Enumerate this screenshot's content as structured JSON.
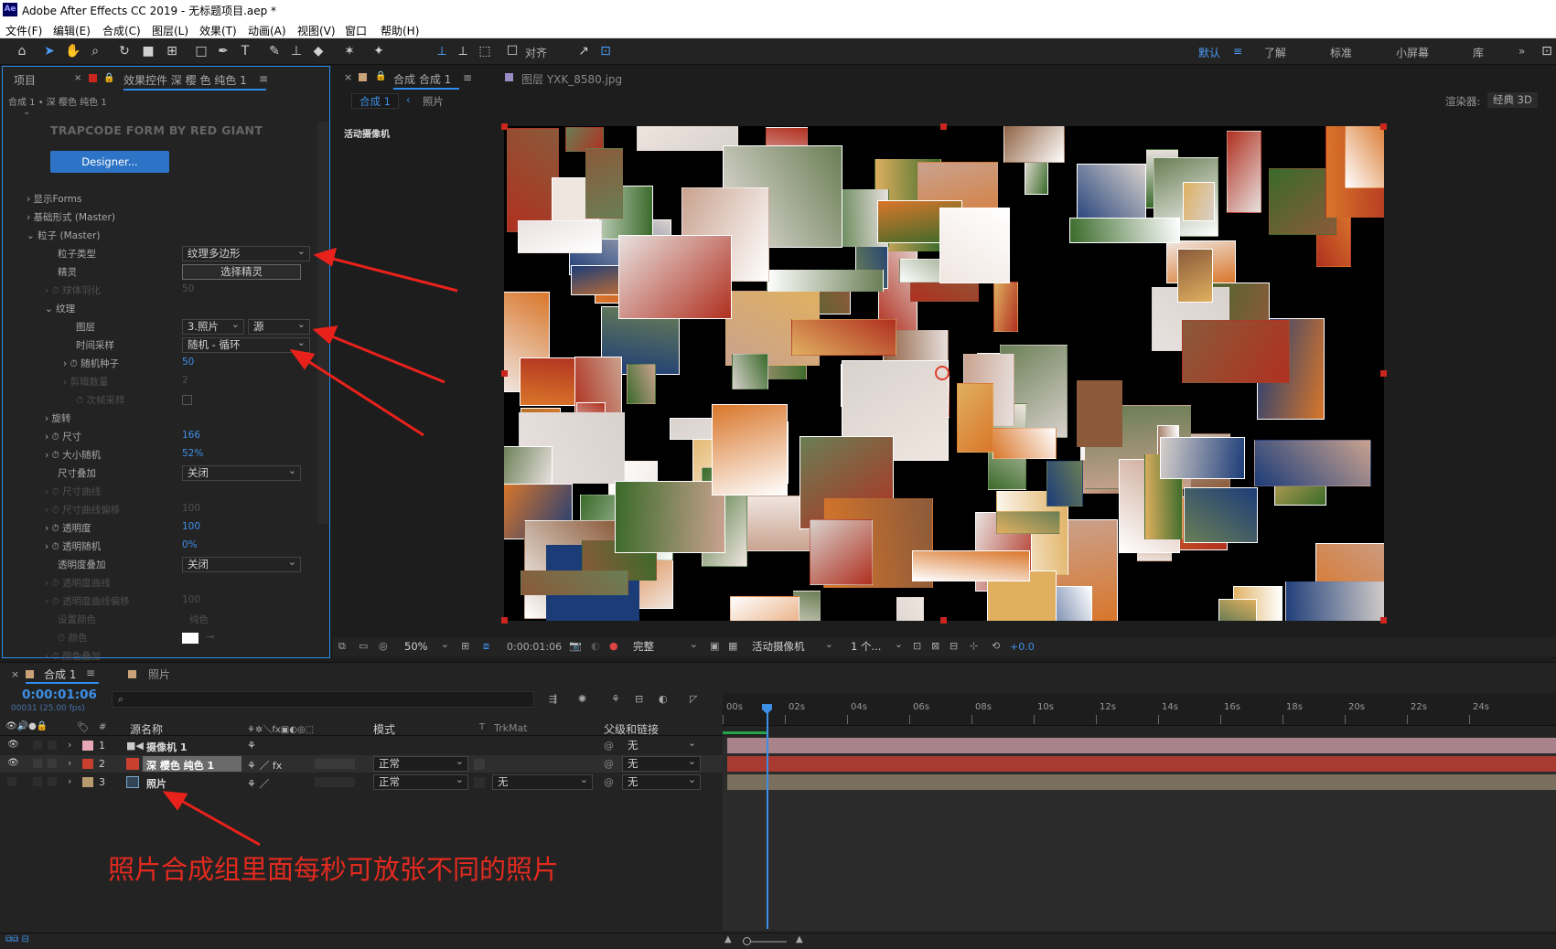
{
  "app": {
    "logo": "Ae",
    "title": "Adobe After Effects CC 2019 - 无标题项目.aep *"
  },
  "menu": [
    "文件(F)",
    "编辑(E)",
    "合成(C)",
    "图层(L)",
    "效果(T)",
    "动画(A)",
    "视图(V)",
    "窗口",
    "帮助(H)"
  ],
  "toolbar": {
    "align_label": "对齐",
    "workspaces": [
      "默认",
      "≡",
      "了解",
      "标准",
      "小屏幕",
      "库",
      "»"
    ]
  },
  "left_panel": {
    "tab_project": "项目",
    "tab_effects": "效果控件 深 樱 色 纯色 1",
    "breadcrumb": "合成 1 • 深 樱色 纯色 1",
    "plugin_title": "TRAPCODE FORM BY RED GIANT",
    "designer_button": "Designer...",
    "rows": [
      {
        "label": "显示Forms"
      },
      {
        "label": "基础形式 (Master)"
      },
      {
        "label": "粒子 (Master)"
      },
      {
        "label": "粒子类型"
      },
      {
        "label": "精灵"
      },
      {
        "label": "球体羽化",
        "value": "50"
      },
      {
        "label": "纹理"
      },
      {
        "label": "图层"
      },
      {
        "label": "时间采样"
      },
      {
        "label": "随机种子",
        "value": "50"
      },
      {
        "label": "剪辑数量",
        "value": "2"
      },
      {
        "label": "次帧采样"
      },
      {
        "label": "旋转"
      },
      {
        "label": "尺寸",
        "value": "166"
      },
      {
        "label": "大小随机",
        "value": "52%"
      },
      {
        "label": "尺寸叠加"
      },
      {
        "label": "尺寸曲线"
      },
      {
        "label": "尺寸曲线偏移",
        "value": "100"
      },
      {
        "label": "透明度",
        "value": "100"
      },
      {
        "label": "透明随机",
        "value": "0%"
      },
      {
        "label": "透明度叠加"
      },
      {
        "label": "透明度曲线"
      },
      {
        "label": "透明度曲线偏移",
        "value": "100"
      },
      {
        "label": "设置颜色",
        "value": "纯色"
      },
      {
        "label": "颜色"
      },
      {
        "label": "颜色叠加"
      }
    ],
    "particle_type": "纹理多边形",
    "sprite_button": "选择精灵",
    "layer_select": "3.照片",
    "layer_source": "源",
    "time_sampling": "随机 - 循环",
    "size_overlay": "关闭",
    "opacity_overlay": "关闭"
  },
  "comp_panel": {
    "tab_comp": "合成 合成 1",
    "tab_layer": "图层 YXK_8580.jpg",
    "sub_comp": "合成 1",
    "sub_photo": "照片",
    "renderer": "渲染器:",
    "renderer_value": "经典 3D",
    "camera_label": "活动摄像机"
  },
  "viewer_bar": {
    "zoom": "50%",
    "time": "0:00:01:06",
    "quality": "完整",
    "camera": "活动摄像机",
    "views": "1 个...",
    "exposure": "+0.0"
  },
  "timeline": {
    "tab_comp": "合成 1",
    "tab_photo": "照片",
    "timecode": "0:00:01:06",
    "frame": "00031 (25.00 fps)",
    "headers": {
      "source": "源名称",
      "mode": "模式",
      "t": "T",
      "trkmat": "TrkMat",
      "parent": "父级和链接"
    },
    "layers": [
      {
        "num": "1",
        "name": "摄像机 1",
        "mode": "",
        "trk": "",
        "parent": "无",
        "color": "#e7a9b6"
      },
      {
        "num": "2",
        "name": "深 樱色 纯色 1",
        "mode": "正常",
        "trk": "",
        "parent": "无",
        "color": "#c9402e"
      },
      {
        "num": "3",
        "name": "照片",
        "mode": "正常",
        "trk": "无",
        "parent": "无",
        "color": "#b89b6f"
      }
    ],
    "ruler": [
      "00s",
      "02s",
      "04s",
      "06s",
      "08s",
      "10s",
      "12s",
      "14s",
      "16s",
      "18s",
      "20s",
      "22s",
      "24s"
    ]
  },
  "annotation": "照片合成组里面每秒可放张不同的照片",
  "colors": {
    "accent": "#2d8ceb",
    "annotation": "#e22a1f"
  }
}
